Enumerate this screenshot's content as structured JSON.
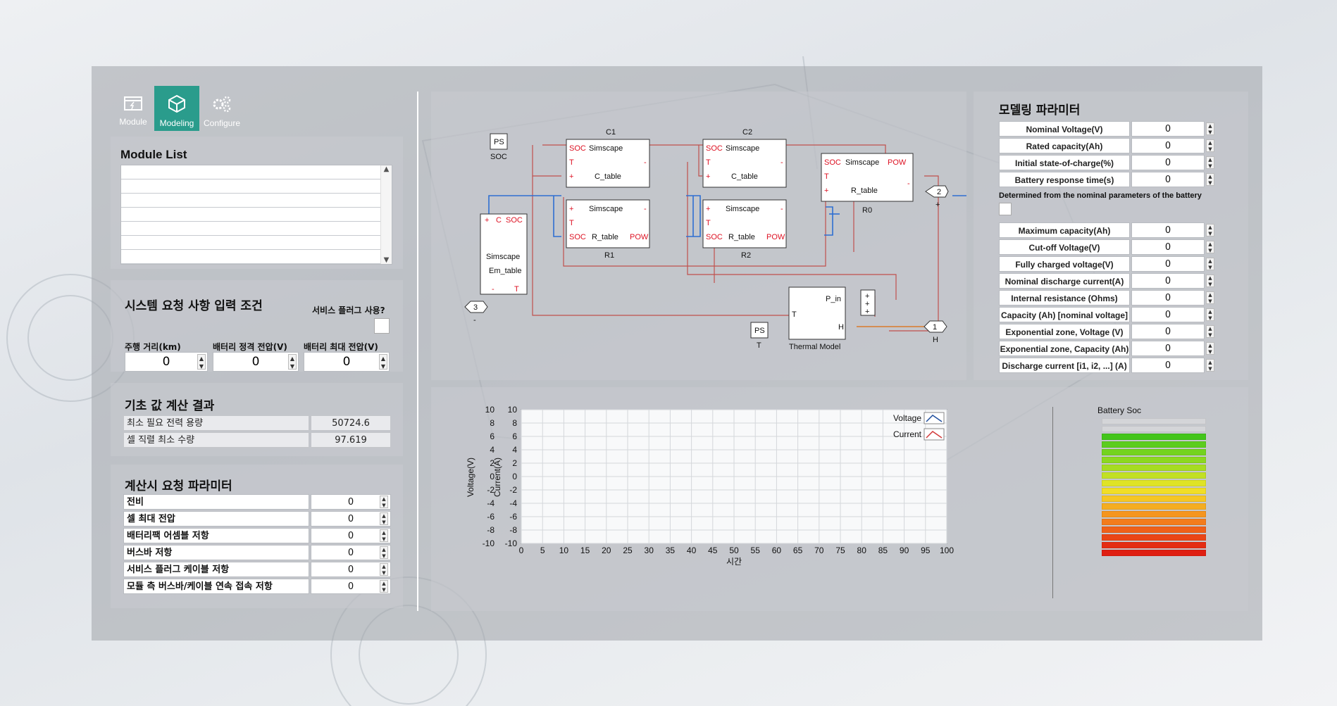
{
  "toolbar": {
    "module_label": "Module",
    "modeling_label": "Modeling",
    "configure_label": "Configure",
    "active": "Modeling"
  },
  "module_list": {
    "title": "Module List",
    "items": [
      "",
      "",
      "",
      "",
      "",
      "",
      ""
    ]
  },
  "system_requirements": {
    "title": "시스템 요청 사항 입력 조건",
    "service_plug_label": "서비스 플러그 사용?",
    "service_plug_checked": false,
    "fields": [
      {
        "label": "주행 거리(km)",
        "value": "0"
      },
      {
        "label": "배터리 정격 전압(V)",
        "value": "0"
      },
      {
        "label": "배터리 최대 전압(V)",
        "value": "0"
      }
    ]
  },
  "basic_results": {
    "title": "기초 값 계산 결과",
    "rows": [
      {
        "label": "최소 필요 전력 용량",
        "value": "50724.6"
      },
      {
        "label": "셀 직렬 최소 수량",
        "value": "97.619"
      }
    ]
  },
  "calc_params": {
    "title": "계산시 요청 파라미터",
    "rows": [
      {
        "label": "전비",
        "value": "0"
      },
      {
        "label": "셀 최대 전압",
        "value": "0"
      },
      {
        "label": "배터리팩 어셈블 저항",
        "value": "0"
      },
      {
        "label": "버스바 저항",
        "value": "0"
      },
      {
        "label": "서비스 플러그 케이블 저항",
        "value": "0"
      },
      {
        "label": "모듈 측 버스바/케이블 연속 접속 저항",
        "value": "0"
      }
    ]
  },
  "diagram": {
    "soc_source": {
      "label": "PS",
      "caption": "SOC"
    },
    "t_source": {
      "label": "PS",
      "caption": "T"
    },
    "em_block": {
      "ports": [
        "+",
        "C",
        "SOC",
        "-",
        "T"
      ],
      "lines": [
        "Simscape",
        "Em_table"
      ]
    },
    "c1": {
      "name": "C1",
      "ports": [
        "SOC",
        "T",
        "+"
      ],
      "lines": [
        "Simscape",
        "C_table"
      ],
      "out": "-"
    },
    "c2": {
      "name": "C2",
      "ports": [
        "SOC",
        "T",
        "+"
      ],
      "lines": [
        "Simscape",
        "C_table"
      ],
      "out": "-"
    },
    "r1": {
      "name": "R1",
      "ports": [
        "+",
        "T",
        "SOC"
      ],
      "lines": [
        "Simscape",
        "R_table"
      ],
      "out": "-",
      "pow": "POW"
    },
    "r2": {
      "name": "R2",
      "ports": [
        "+",
        "T",
        "SOC"
      ],
      "lines": [
        "Simscape",
        "R_table"
      ],
      "out": "-",
      "pow": "POW"
    },
    "r0": {
      "name": "R0",
      "ports": [
        "SOC",
        "T",
        "+"
      ],
      "lines": [
        "Simscape",
        "R_table"
      ],
      "out": "-",
      "pow": "POW"
    },
    "thermal": {
      "name": "Thermal Model",
      "in1": "P_in",
      "in2": "T",
      "out": "H"
    },
    "sum_signs": [
      "+",
      "+",
      "+"
    ],
    "port2": {
      "num": "2",
      "sign": "+"
    },
    "port3": {
      "num": "3",
      "sign": "-"
    },
    "port1": {
      "num": "1",
      "caption": "H"
    }
  },
  "chart_data": {
    "type": "line",
    "title": "",
    "xlabel": "시간",
    "ylabel_left1": "Voltage(V)",
    "ylabel_left2": "Current(A)",
    "xlim": [
      0,
      100
    ],
    "ylim": [
      -10,
      10
    ],
    "x_ticks": [
      0,
      5,
      10,
      15,
      20,
      25,
      30,
      35,
      40,
      45,
      50,
      55,
      60,
      65,
      70,
      75,
      80,
      85,
      90,
      95,
      100
    ],
    "y_ticks": [
      10,
      8,
      6,
      4,
      2,
      0,
      -2,
      -4,
      -6,
      -8,
      -10
    ],
    "grid": true,
    "legend_position": "top-right",
    "series": [
      {
        "name": "Voltage",
        "x": [],
        "y": [],
        "color": "#1f4e9e"
      },
      {
        "name": "Current",
        "x": [],
        "y": [],
        "color": "#d23a3a"
      }
    ]
  },
  "battery_soc": {
    "title": "Battery Soc",
    "empty_color": "#d4d5d8",
    "bar_colors": [
      "#d4d5d8",
      "#d4d5d8",
      "#43c51a",
      "#5ccd1e",
      "#74d31f",
      "#8cd820",
      "#a6dc22",
      "#c2e024",
      "#dfe326",
      "#f1de26",
      "#f5c624",
      "#f5ad21",
      "#f5951e",
      "#f37c1c",
      "#ef6019",
      "#ea4516",
      "#e42d13",
      "#df1f12"
    ]
  },
  "modeling_params": {
    "title": "모델링 파라미터",
    "top_rows": [
      {
        "label": "Nominal Voltage(V)",
        "value": "0"
      },
      {
        "label": "Rated capacity(Ah)",
        "value": "0"
      },
      {
        "label": "Initial state-of-charge(%)",
        "value": "0"
      },
      {
        "label": "Battery response time(s)",
        "value": "0"
      }
    ],
    "determined_label": "Determined from the nominal parameters of the battery",
    "determined_checked": false,
    "bottom_rows": [
      {
        "label": "Maximum capacity(Ah)",
        "value": "0"
      },
      {
        "label": "Cut-off Voltage(V)",
        "value": "0"
      },
      {
        "label": "Fully charged voltage(V)",
        "value": "0"
      },
      {
        "label": "Nominal discharge current(A)",
        "value": "0"
      },
      {
        "label": "Internal resistance (Ohms)",
        "value": "0"
      },
      {
        "label": "Capacity (Ah) [nominal voltage]",
        "value": "0"
      },
      {
        "label": "Exponential zone, Voltage (V)",
        "value": "0"
      },
      {
        "label": "Exponential zone, Capacity (Ah)",
        "value": "0"
      },
      {
        "label": "Discharge current [i1, i2, ...] (A)",
        "value": "0"
      }
    ]
  }
}
